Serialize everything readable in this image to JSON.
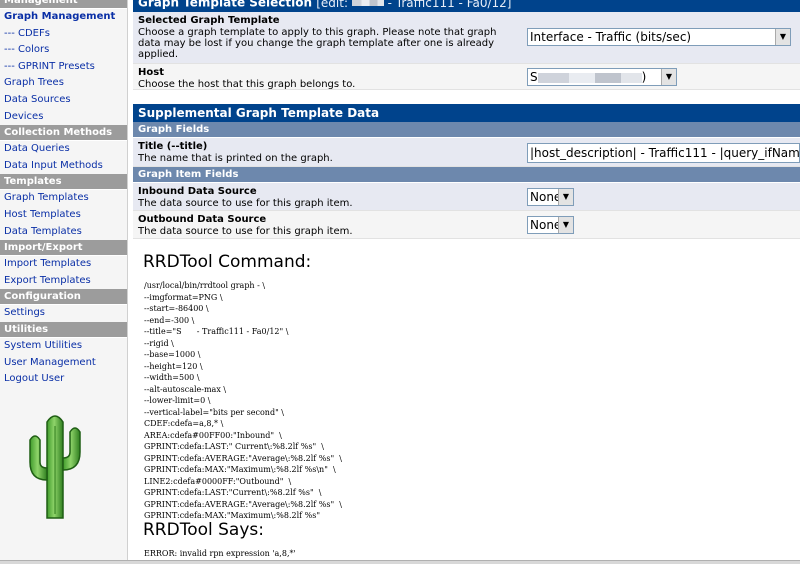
{
  "sidebar": {
    "cut_header": "Management",
    "items": [
      {
        "label": "Graph Management",
        "type": "item",
        "active": true
      },
      {
        "label": "--- CDEFs",
        "type": "sub"
      },
      {
        "label": "--- Colors",
        "type": "sub"
      },
      {
        "label": "--- GPRINT Presets",
        "type": "sub"
      },
      {
        "label": "Graph Trees",
        "type": "item"
      },
      {
        "label": "Data Sources",
        "type": "item"
      },
      {
        "label": "Devices",
        "type": "item"
      },
      {
        "label": "Collection Methods",
        "type": "head"
      },
      {
        "label": "Data Queries",
        "type": "item"
      },
      {
        "label": "Data Input Methods",
        "type": "item"
      },
      {
        "label": "Templates",
        "type": "head"
      },
      {
        "label": "Graph Templates",
        "type": "item"
      },
      {
        "label": "Host Templates",
        "type": "item"
      },
      {
        "label": "Data Templates",
        "type": "item"
      },
      {
        "label": "Import/Export",
        "type": "head"
      },
      {
        "label": "Import Templates",
        "type": "item"
      },
      {
        "label": "Export Templates",
        "type": "item"
      },
      {
        "label": "Configuration",
        "type": "head"
      },
      {
        "label": "Settings",
        "type": "item"
      },
      {
        "label": "Utilities",
        "type": "head"
      },
      {
        "label": "System Utilities",
        "type": "item"
      },
      {
        "label": "User Management",
        "type": "item"
      },
      {
        "label": "Logout User",
        "type": "item"
      }
    ],
    "logo_icon": "cactus-icon"
  },
  "graph_template_selection": {
    "title": "Graph Template Selection",
    "edit_prefix": "[edit: ",
    "edit_suffix": " - Traffic111 - Fa0/12]",
    "selected_template_label": "Selected Graph Template",
    "selected_template_desc": "Choose a graph template to apply to this graph. Please note that graph data may be lost if you change the graph template after one is already applied.",
    "selected_template_value": "Interface - Traffic (bits/sec)",
    "host_label": "Host",
    "host_desc": "Choose the host that this graph belongs to.",
    "host_value_prefix": "S",
    "host_value_suffix": ")"
  },
  "supplemental": {
    "title": "Supplemental Graph Template Data",
    "graph_fields_header": "Graph Fields",
    "title_label": "Title (--title)",
    "title_desc": "The name that is printed on the graph.",
    "title_value": "|host_description| - Traffic111 - |query_ifNam",
    "graph_item_fields_header": "Graph Item Fields",
    "inbound_label": "Inbound Data Source",
    "inbound_desc": "The data source to use for this graph item.",
    "inbound_value": "None",
    "outbound_label": "Outbound Data Source",
    "outbound_desc": "The data source to use for this graph item.",
    "outbound_value": "None"
  },
  "rrdtool": {
    "command_heading": "RRDTool Command:",
    "command_lines": [
      "/usr/local/bin/rrdtool graph - \\",
      "--imgformat=PNG \\",
      "--start=-86400 \\",
      "--end=-300 \\",
      "--title=\"S      - Traffic111 - Fa0/12\" \\",
      "--rigid \\",
      "--base=1000 \\",
      "--height=120 \\",
      "--width=500 \\",
      "--alt-autoscale-max \\",
      "--lower-limit=0 \\",
      "--vertical-label=\"bits per second\" \\",
      "CDEF:cdefa=a,8,* \\",
      "AREA:cdefa#00FF00:\"Inbound\"  \\",
      "GPRINT:cdefa:LAST:\" Current\\:%8.2lf %s\"  \\",
      "GPRINT:cdefa:AVERAGE:\"Average\\:%8.2lf %s\"  \\",
      "GPRINT:cdefa:MAX:\"Maximum\\:%8.2lf %s\\n\"  \\",
      "LINE2:cdefa#0000FF:\"Outbound\"  \\",
      "GPRINT:cdefa:LAST:\"Current\\:%8.2lf %s\"  \\",
      "GPRINT:cdefa:AVERAGE:\"Average\\:%8.2lf %s\"  \\",
      "GPRINT:cdefa:MAX:\"Maximum\\:%8.2lf %s\""
    ],
    "says_heading": "RRDTool Says:",
    "says_text": "ERROR: invalid rpn expression 'a,8,*'"
  },
  "colors": {
    "title_bar": "#00438c",
    "section_bar": "#6d88ad",
    "nav_header": "#9c9c9c",
    "link": "#0a2fa6"
  }
}
